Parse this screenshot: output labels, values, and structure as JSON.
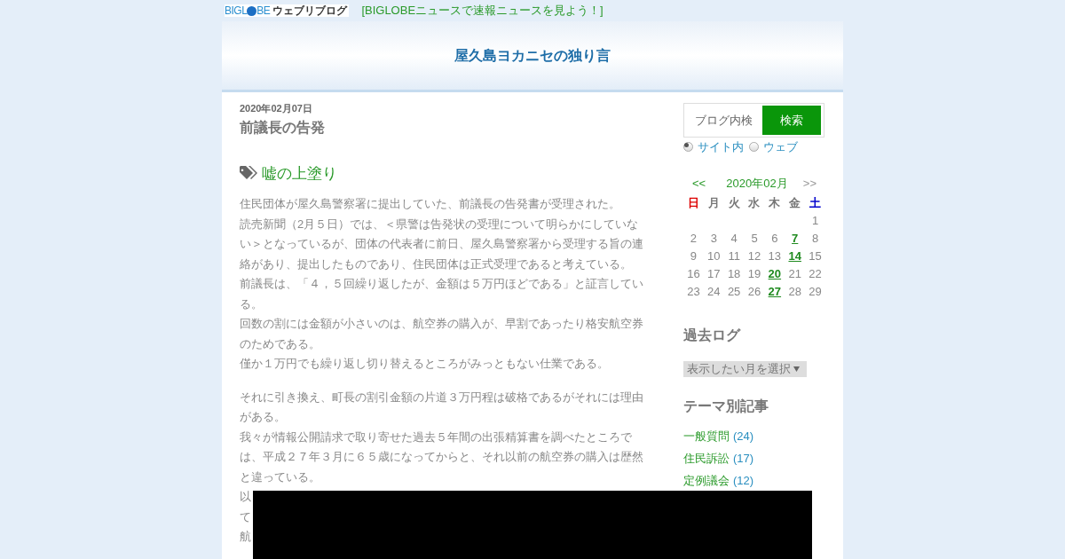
{
  "topbar": {
    "logo": {
      "brand_start": "BIGL",
      "brand_end": "BE",
      "service": "ウェブリブログ"
    },
    "news_link": "[BIGLOBEニュースで速報ニュースを見よう！]"
  },
  "header": {
    "title": "屋久島ヨカニセの独り言"
  },
  "post": {
    "date": "2020年02月07日",
    "title": "前議長の告発",
    "theme": "嘘の上塗り",
    "paragraphs": [
      {
        "lines": [
          "住民団体が屋久島警察署に提出していた、前議長の告発書が受理された。",
          "読売新聞（2月５日）では、＜県警は告発状の受理について明らかにしていな",
          "い＞となっているが、団体の代表者に前日、屋久島警察署から受理する旨の連",
          "絡があり、提出したものであり、住民団体は正式受理であると考えている。",
          "前議長は、「４，５回繰り返したが、金額は５万円ほどである」と証言してい",
          "る。",
          "回数の割には金額が小さいのは、航空券の購入が、早割であったり格安航空券",
          "のためである。",
          "僅か１万円でも繰り返し切り替えるところがみっともない仕業である。"
        ]
      },
      {
        "lines": [
          "それに引き換え、町長の割引金額の片道３万円程は破格であるがそれには理由",
          "がある。",
          "我々が情報公開請求で取り寄せた過去５年間の出張精算書を調べたところで",
          "は、平成２７年３月に６５歳になってからと、それ以前の航空券の購入は歴然",
          "と違っている。",
          "以",
          "て",
          "航"
        ]
      }
    ]
  },
  "sidebar": {
    "search": {
      "placeholder": "ブログ内検",
      "button": "検索",
      "scopes": [
        {
          "label": "サイト内",
          "selected": true
        },
        {
          "label": "ウェブ",
          "selected": false
        }
      ]
    },
    "calendar": {
      "prev": "<<",
      "month": "2020年02月",
      "next": ">>",
      "weekdays": [
        {
          "label": "日",
          "color": "#dd0000"
        },
        {
          "label": "月",
          "color": "#777777"
        },
        {
          "label": "火",
          "color": "#777777"
        },
        {
          "label": "水",
          "color": "#777777"
        },
        {
          "label": "木",
          "color": "#777777"
        },
        {
          "label": "金",
          "color": "#777777"
        },
        {
          "label": "土",
          "color": "#0000cc"
        }
      ],
      "weeks": [
        [
          {
            "day": "1",
            "linked": false
          }
        ],
        [
          {
            "day": "2",
            "linked": false
          },
          {
            "day": "3",
            "linked": false
          },
          {
            "day": "4",
            "linked": false
          },
          {
            "day": "5",
            "linked": false
          },
          {
            "day": "6",
            "linked": false
          },
          {
            "day": "7",
            "linked": true
          },
          {
            "day": "8",
            "linked": false
          }
        ],
        [
          {
            "day": "9",
            "linked": false
          },
          {
            "day": "10",
            "linked": false
          },
          {
            "day": "11",
            "linked": false
          },
          {
            "day": "12",
            "linked": false
          },
          {
            "day": "13",
            "linked": false
          },
          {
            "day": "14",
            "linked": true
          },
          {
            "day": "15",
            "linked": false
          }
        ],
        [
          {
            "day": "16",
            "linked": false
          },
          {
            "day": "17",
            "linked": false
          },
          {
            "day": "18",
            "linked": false
          },
          {
            "day": "19",
            "linked": false
          },
          {
            "day": "20",
            "linked": true
          },
          {
            "day": "21",
            "linked": false
          },
          {
            "day": "22",
            "linked": false
          }
        ],
        [
          {
            "day": "23",
            "linked": false
          },
          {
            "day": "24",
            "linked": false
          },
          {
            "day": "25",
            "linked": false
          },
          {
            "day": "26",
            "linked": false
          },
          {
            "day": "27",
            "linked": true
          },
          {
            "day": "28",
            "linked": false
          },
          {
            "day": "29",
            "linked": false
          }
        ]
      ]
    },
    "archive": {
      "heading": "過去ログ",
      "select": "表示したい月を選択"
    },
    "themes": {
      "heading": "テーマ別記事",
      "items": [
        {
          "name": "一般質問",
          "count": "(24)"
        },
        {
          "name": "住民訴訟",
          "count": "(17)"
        },
        {
          "name": "定例議会",
          "count": "(12)"
        }
      ]
    }
  }
}
